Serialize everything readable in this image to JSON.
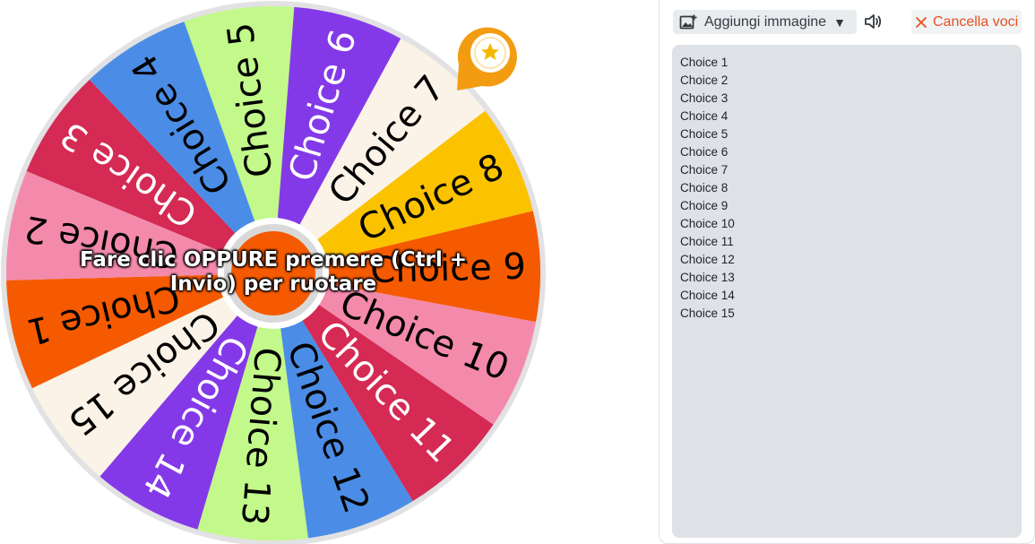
{
  "wheel": {
    "segments": [
      {
        "label": "Choice 1",
        "color": "#f55a00",
        "text_color": "#000000"
      },
      {
        "label": "Choice 2",
        "color": "#f48aab",
        "text_color": "#000000"
      },
      {
        "label": "Choice 3",
        "color": "#d42a54",
        "text_color": "#ffffff"
      },
      {
        "label": "Choice 4",
        "color": "#4b8de6",
        "text_color": "#000000"
      },
      {
        "label": "Choice 5",
        "color": "#c2f98a",
        "text_color": "#000000"
      },
      {
        "label": "Choice 6",
        "color": "#8439e8",
        "text_color": "#ffffff"
      },
      {
        "label": "Choice 7",
        "color": "#fbf3e7",
        "text_color": "#000000"
      },
      {
        "label": "Choice 8",
        "color": "#fbc200",
        "text_color": "#000000"
      },
      {
        "label": "Choice 9",
        "color": "#f55a00",
        "text_color": "#000000"
      },
      {
        "label": "Choice 10",
        "color": "#f48aab",
        "text_color": "#000000"
      },
      {
        "label": "Choice 11",
        "color": "#d42a54",
        "text_color": "#ffffff"
      },
      {
        "label": "Choice 12",
        "color": "#4b8de6",
        "text_color": "#000000"
      },
      {
        "label": "Choice 13",
        "color": "#c2f98a",
        "text_color": "#000000"
      },
      {
        "label": "Choice 14",
        "color": "#8439e8",
        "text_color": "#ffffff"
      },
      {
        "label": "Choice 15",
        "color": "#fbf3e7",
        "text_color": "#000000"
      }
    ],
    "spin_prompt": "Fare clic OPPURE premere (Ctrl + Invio) per ruotare",
    "center_color": "#f55a00",
    "pointer_color": "#f39c12"
  },
  "toolbar": {
    "add_image_label": "Aggiungi immagine",
    "dropdown_caret": "▼",
    "clear_label": "Cancella voci",
    "clear_color": "#e8501f"
  },
  "entries": {
    "text": "Choice 1\nChoice 2\nChoice 3\nChoice 4\nChoice 5\nChoice 6\nChoice 7\nChoice 8\nChoice 9\nChoice 10\nChoice 11\nChoice 12\nChoice 13\nChoice 14\nChoice 15"
  }
}
